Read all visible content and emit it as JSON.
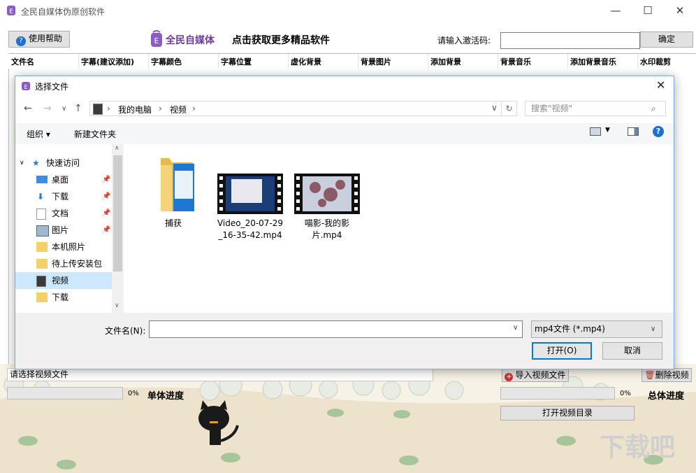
{
  "app": {
    "title": "全民自媒体伪原创软件",
    "help_label": "使用帮助",
    "brand_name": "全民自媒体",
    "promo_text": "点击获取更多精品软件",
    "activation_label": "请输入激活码:",
    "activation_value": "",
    "confirm_label": "确定"
  },
  "table": {
    "columns": [
      "文件名",
      "字幕(建议添加)",
      "字幕颜色",
      "字幕位置",
      "虚化背景",
      "背景图片",
      "添加背景",
      "背景音乐",
      "添加背景音乐",
      "水印裁剪"
    ]
  },
  "bottom": {
    "status_text": "请选择视频文件",
    "import_label": "导入视频文件",
    "delete_label": "删除视频",
    "single_progress": 0,
    "single_percent_text": "0%",
    "single_label": "单体进度",
    "total_progress": 0,
    "total_percent_text": "0%",
    "total_label": "总体进度",
    "open_dir_label": "打开视频目录",
    "watermark_text": "下载吧"
  },
  "dialog": {
    "title": "选择文件",
    "breadcrumb": [
      "我的电脑",
      "视频"
    ],
    "search_placeholder": "搜索\"视频\"",
    "organize_label": "组织 ▾",
    "new_folder_label": "新建文件夹",
    "tree": [
      {
        "label": "快速访问",
        "icon": "star-icon",
        "pinned": false
      },
      {
        "label": "桌面",
        "icon": "desktop-icon",
        "pinned": true
      },
      {
        "label": "下载",
        "icon": "download-icon",
        "pinned": true
      },
      {
        "label": "文档",
        "icon": "document-icon",
        "pinned": true
      },
      {
        "label": "图片",
        "icon": "pictures-icon",
        "pinned": true
      },
      {
        "label": "本机照片",
        "icon": "folder-icon",
        "pinned": false
      },
      {
        "label": "待上传安装包",
        "icon": "folder-icon",
        "pinned": false
      },
      {
        "label": "视频",
        "icon": "video-icon",
        "pinned": false,
        "selected": true
      },
      {
        "label": "下载",
        "icon": "folder-icon",
        "pinned": false
      }
    ],
    "files": [
      {
        "name": "捕获",
        "type": "folder"
      },
      {
        "name": "Video_20-07-29_16-35-42.mp4",
        "type": "video"
      },
      {
        "name": "喵影-我的影片.mp4",
        "type": "video"
      }
    ],
    "filename_label": "文件名(N):",
    "filename_value": "",
    "filetype_value": "mp4文件 (*.mp4)",
    "open_label": "打开(O)",
    "cancel_label": "取消"
  },
  "colors": {
    "brand": "#6b3d9a",
    "accent": "#0078d7",
    "selection": "#cce8ff"
  }
}
